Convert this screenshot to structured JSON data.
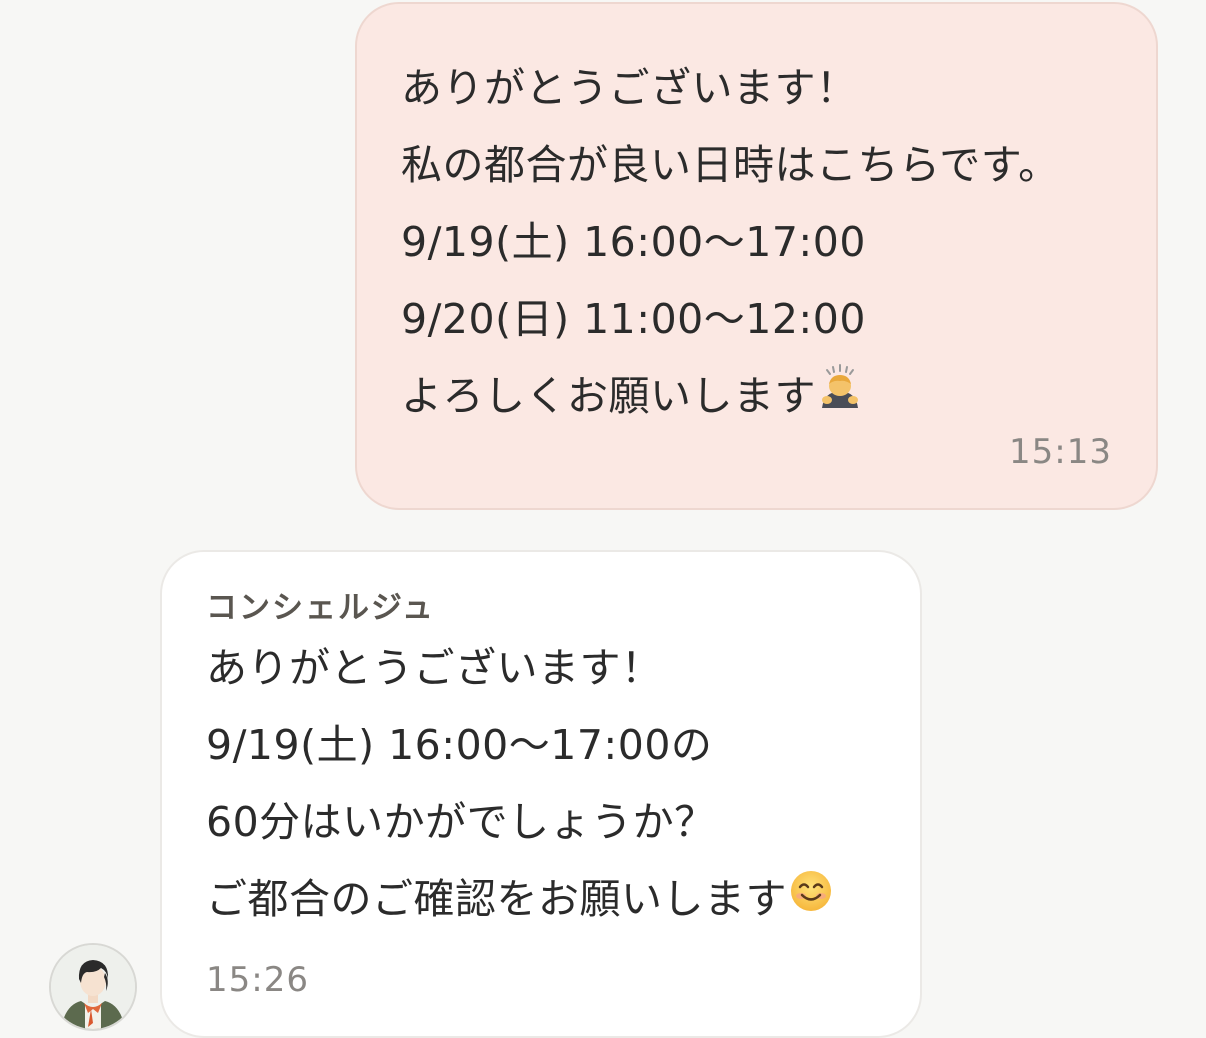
{
  "messages": [
    {
      "direction": "outgoing",
      "lines": [
        "ありがとうございます！",
        "私の都合が良い日時はこちらです。",
        "9/19(土) 16:00〜17:00",
        "9/20(日) 11:00〜12:00",
        "よろしくお願いします"
      ],
      "emoji": "person-bowing-emoji",
      "time": "15:13"
    },
    {
      "direction": "incoming",
      "sender": "コンシェルジュ",
      "lines": [
        "ありがとうございます！",
        "9/19(土) 16:00〜17:00の",
        "60分はいかがでしょうか？",
        "ご都合のご確認をお願いします"
      ],
      "emoji": "smiling-face-emoji",
      "time": "15:26"
    }
  ],
  "colors": {
    "background": "#f7f7f5",
    "outgoing_bubble": "#fbe8e3",
    "incoming_bubble": "#ffffff",
    "timestamp": "#8a8784",
    "sender_name": "#5a5650"
  }
}
